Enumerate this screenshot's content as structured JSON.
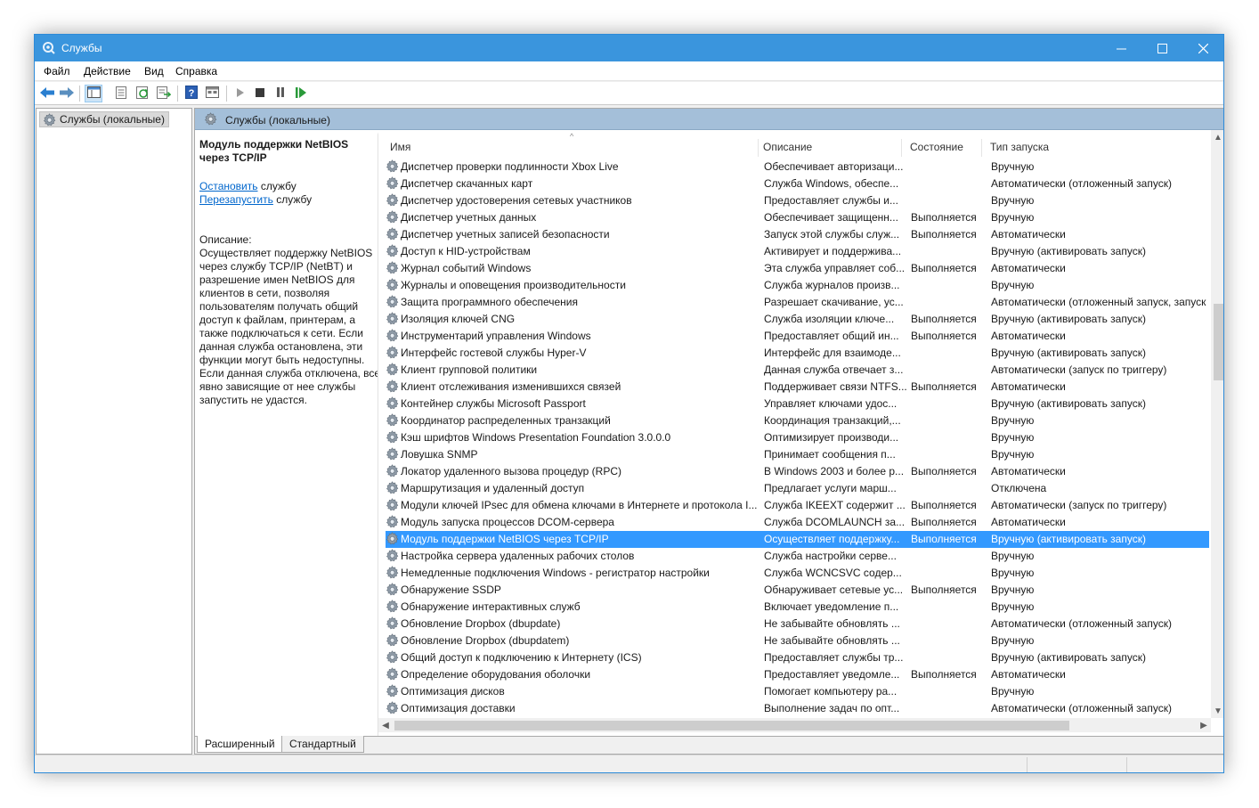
{
  "window": {
    "title": "Службы",
    "accent_color": "#3a95dd",
    "selection_color": "#3399ff",
    "controls": [
      "minimize-icon",
      "maximize-icon",
      "close-icon"
    ]
  },
  "menu": [
    {
      "label": "Файл"
    },
    {
      "label": "Действие"
    },
    {
      "label": "Вид"
    },
    {
      "label": "Справка"
    }
  ],
  "toolbar": {
    "icons": [
      "back-arrow-icon",
      "forward-arrow-icon",
      "console-tree-icon",
      "properties-icon",
      "refresh-icon",
      "export-list-icon",
      "help-icon",
      "mmc-view-icon",
      "start-service-icon",
      "stop-service-icon",
      "pause-service-icon",
      "resume-service-icon"
    ]
  },
  "tree": {
    "root_label": "Службы (локальные)"
  },
  "panel": {
    "title": "Службы (локальные)"
  },
  "details": {
    "service_name": "Модуль поддержки NetBIOS через TCP/IP",
    "stop_link": "Остановить",
    "stop_suffix": " службу",
    "restart_link": "Перезапустить",
    "restart_suffix": " службу",
    "description_label": "Описание:",
    "description_text": "Осуществляет поддержку NetBIOS через службу TCP/IP (NetBT) и разрешение имен NetBIOS для клиентов в сети, позволяя пользователям получать общий доступ к файлам, принтерам, а также подключаться к сети. Если данная служба остановлена, эти функции могут быть недоступны. Если данная служба отключена, все явно зависящие от нее службы запустить не удастся."
  },
  "columns": {
    "name": "Имя",
    "description": "Описание",
    "status": "Состояние",
    "startup": "Тип запуска"
  },
  "services": [
    {
      "name": "Диспетчер проверки подлинности Xbox Live",
      "description": "Обеспечивает авторизаци...",
      "status": "",
      "startup": "Вручную",
      "selected": false
    },
    {
      "name": "Диспетчер скачанных карт",
      "description": "Служба Windows, обеспе...",
      "status": "",
      "startup": "Автоматически (отложенный запуск)",
      "selected": false
    },
    {
      "name": "Диспетчер удостоверения сетевых участников",
      "description": "Предоставляет службы и...",
      "status": "",
      "startup": "Вручную",
      "selected": false
    },
    {
      "name": "Диспетчер учетных данных",
      "description": "Обеспечивает защищенн...",
      "status": "Выполняется",
      "startup": "Вручную",
      "selected": false
    },
    {
      "name": "Диспетчер учетных записей безопасности",
      "description": "Запуск этой службы служ...",
      "status": "Выполняется",
      "startup": "Автоматически",
      "selected": false
    },
    {
      "name": "Доступ к HID-устройствам",
      "description": "Активирует и поддержива...",
      "status": "",
      "startup": "Вручную (активировать запуск)",
      "selected": false
    },
    {
      "name": "Журнал событий Windows",
      "description": "Эта служба управляет соб...",
      "status": "Выполняется",
      "startup": "Автоматически",
      "selected": false
    },
    {
      "name": "Журналы и оповещения производительности",
      "description": "Служба журналов произв...",
      "status": "",
      "startup": "Вручную",
      "selected": false
    },
    {
      "name": "Защита программного обеспечения",
      "description": "Разрешает скачивание, ус...",
      "status": "",
      "startup": "Автоматически (отложенный запуск, запуск",
      "selected": false
    },
    {
      "name": "Изоляция ключей CNG",
      "description": "Служба изоляции ключе...",
      "status": "Выполняется",
      "startup": "Вручную (активировать запуск)",
      "selected": false
    },
    {
      "name": "Инструментарий управления Windows",
      "description": "Предоставляет общий ин...",
      "status": "Выполняется",
      "startup": "Автоматически",
      "selected": false
    },
    {
      "name": "Интерфейс гостевой службы Hyper-V",
      "description": "Интерфейс для взаимоде...",
      "status": "",
      "startup": "Вручную (активировать запуск)",
      "selected": false
    },
    {
      "name": "Клиент групповой политики",
      "description": "Данная служба отвечает з...",
      "status": "",
      "startup": "Автоматически (запуск по триггеру)",
      "selected": false
    },
    {
      "name": "Клиент отслеживания изменившихся связей",
      "description": "Поддерживает связи NTFS...",
      "status": "Выполняется",
      "startup": "Автоматически",
      "selected": false
    },
    {
      "name": "Контейнер службы Microsoft Passport",
      "description": "Управляет ключами удос...",
      "status": "",
      "startup": "Вручную (активировать запуск)",
      "selected": false
    },
    {
      "name": "Координатор распределенных транзакций",
      "description": "Координация транзакций,...",
      "status": "",
      "startup": "Вручную",
      "selected": false
    },
    {
      "name": "Кэш шрифтов Windows Presentation Foundation 3.0.0.0",
      "description": "Оптимизирует производи...",
      "status": "",
      "startup": "Вручную",
      "selected": false
    },
    {
      "name": "Ловушка SNMP",
      "description": "Принимает сообщения п...",
      "status": "",
      "startup": "Вручную",
      "selected": false
    },
    {
      "name": "Локатор удаленного вызова процедур (RPC)",
      "description": "В Windows 2003 и более р...",
      "status": "Выполняется",
      "startup": "Автоматически",
      "selected": false
    },
    {
      "name": "Маршрутизация и удаленный доступ",
      "description": "Предлагает услуги марш...",
      "status": "",
      "startup": "Отключена",
      "selected": false
    },
    {
      "name": "Модули ключей IPsec для обмена ключами в Интернете и протокола I...",
      "description": "Служба IKEEXT содержит ...",
      "status": "Выполняется",
      "startup": "Автоматически (запуск по триггеру)",
      "selected": false
    },
    {
      "name": "Модуль запуска процессов DCOM-сервера",
      "description": "Служба DCOMLAUNCH за...",
      "status": "Выполняется",
      "startup": "Автоматически",
      "selected": false
    },
    {
      "name": "Модуль поддержки NetBIOS через TCP/IP",
      "description": "Осуществляет поддержку...",
      "status": "Выполняется",
      "startup": "Вручную (активировать запуск)",
      "selected": true
    },
    {
      "name": "Настройка сервера удаленных рабочих столов",
      "description": "Служба настройки серве...",
      "status": "",
      "startup": "Вручную",
      "selected": false
    },
    {
      "name": "Немедленные подключения Windows - регистратор настройки",
      "description": "Служба WCNCSVC содер...",
      "status": "",
      "startup": "Вручную",
      "selected": false
    },
    {
      "name": "Обнаружение SSDP",
      "description": "Обнаруживает сетевые ус...",
      "status": "Выполняется",
      "startup": "Вручную",
      "selected": false
    },
    {
      "name": "Обнаружение интерактивных служб",
      "description": "Включает уведомление п...",
      "status": "",
      "startup": "Вручную",
      "selected": false
    },
    {
      "name": "Обновление Dropbox (dbupdate)",
      "description": "Не забывайте обновлять ...",
      "status": "",
      "startup": "Автоматически (отложенный запуск)",
      "selected": false
    },
    {
      "name": "Обновление Dropbox (dbupdatem)",
      "description": "Не забывайте обновлять ...",
      "status": "",
      "startup": "Вручную",
      "selected": false
    },
    {
      "name": "Общий доступ к подключению к Интернету (ICS)",
      "description": "Предоставляет службы тр...",
      "status": "",
      "startup": "Вручную (активировать запуск)",
      "selected": false
    },
    {
      "name": "Определение оборудования оболочки",
      "description": "Предоставляет уведомле...",
      "status": "Выполняется",
      "startup": "Автоматически",
      "selected": false
    },
    {
      "name": "Оптимизация дисков",
      "description": "Помогает компьютеру ра...",
      "status": "",
      "startup": "Вручную",
      "selected": false
    },
    {
      "name": "Оптимизация доставки",
      "description": "Выполнение задач по опт...",
      "status": "",
      "startup": "Автоматически (отложенный запуск)",
      "selected": false
    }
  ],
  "tabs": {
    "extended": "Расширенный",
    "standard": "Стандартный"
  }
}
